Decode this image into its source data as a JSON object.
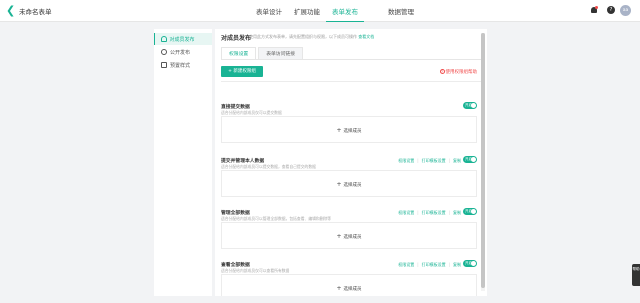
{
  "header": {
    "form_name": "未命名表单",
    "nav": [
      {
        "label": "表单设计"
      },
      {
        "label": "扩展功能"
      },
      {
        "label": "表单发布"
      },
      {
        "label": "数据管理"
      }
    ],
    "avatar_text": "aa"
  },
  "sidebar": {
    "items": [
      {
        "label": "对成员发布",
        "icon": "user-icon"
      },
      {
        "label": "公开发布",
        "icon": "globe-icon"
      },
      {
        "label": "预置样式",
        "icon": "page-icon"
      }
    ]
  },
  "main": {
    "title": "对成员发布",
    "description": "使用此方式发布表单，请先配置组织与权限，以下成员可操作",
    "description_link": "查看文档",
    "tabs": [
      {
        "label": "权限设置"
      },
      {
        "label": "表单访问链接"
      }
    ],
    "add_button": "+ 新建权限组",
    "help_link": "使用权限组帮助",
    "member_button": "选择成员",
    "permissions": [
      {
        "title": "直接提交数据",
        "desc": "适合分配给内部成员仅可以提交数据",
        "actions": [],
        "toggle": "开启"
      },
      {
        "title": "提交并管理本人数据",
        "desc": "适合分配给内部成员可以提交数据，查看自己提交的数据",
        "actions": [
          "权限设置",
          "打印模板设置",
          "复制"
        ],
        "toggle": "开启"
      },
      {
        "title": "管理全部数据",
        "desc": "适合分配给内部成员可以管理全部数据，包括查看、编辑和删除等",
        "actions": [
          "权限设置",
          "打印模板设置",
          "复制"
        ],
        "toggle": "开启"
      },
      {
        "title": "查看全部数据",
        "desc": "适合分配给内部成员仅可以查看所有数据",
        "actions": [
          "权限设置",
          "打印模板设置",
          "复制"
        ],
        "toggle": "开启"
      }
    ]
  },
  "float_badge": "帮助",
  "colors": {
    "accent": "#19b394",
    "danger": "#f04b4b"
  }
}
